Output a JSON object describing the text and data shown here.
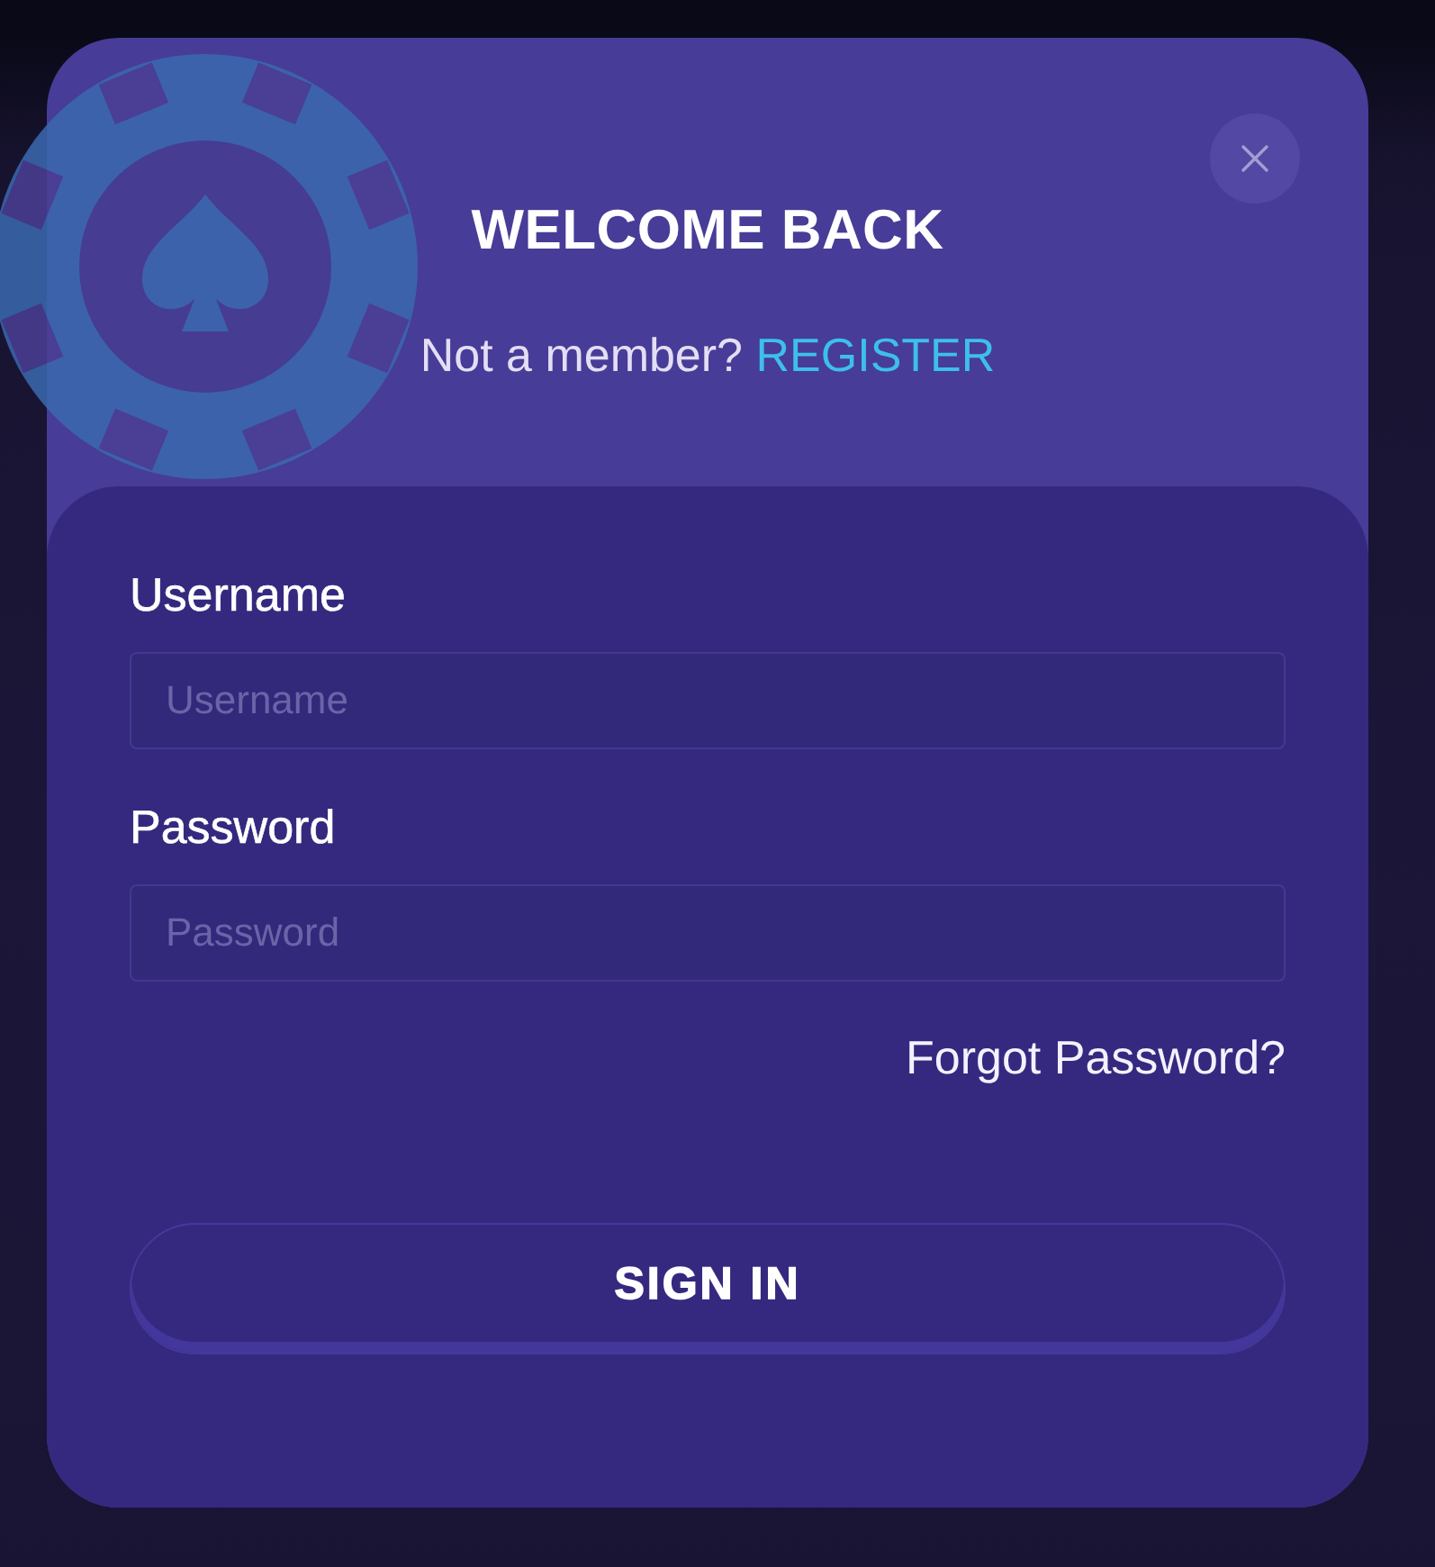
{
  "dialog": {
    "title": "WELCOME BACK",
    "prompt": "Not a member?",
    "register_link": "REGISTER"
  },
  "form": {
    "fields": [
      {
        "label": "Username",
        "placeholder": "Username"
      },
      {
        "label": "Password",
        "placeholder": "Password"
      }
    ],
    "forgot_link": "Forgot Password?",
    "submit": "SIGN IN"
  }
}
